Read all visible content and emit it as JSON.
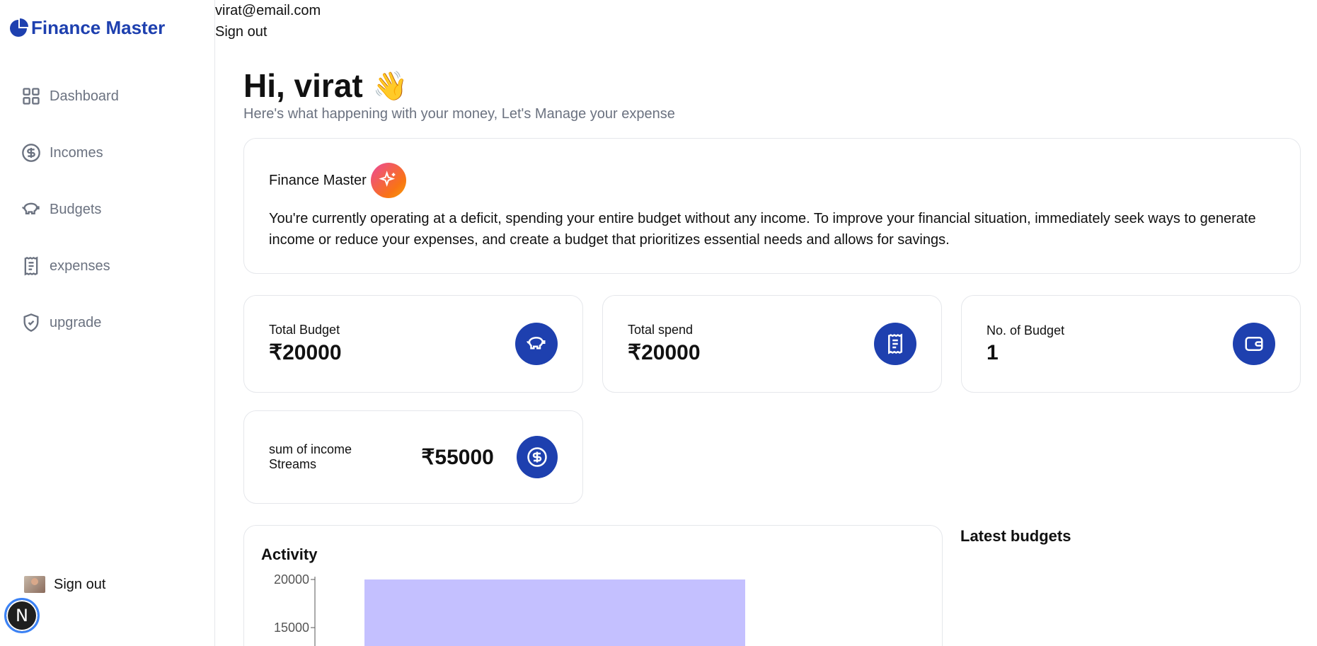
{
  "app": {
    "name": "Finance Master",
    "brand_color": "#1e40af"
  },
  "sidebar": {
    "items": [
      {
        "label": "Dashboard",
        "icon": "grid-icon"
      },
      {
        "label": "Incomes",
        "icon": "dollar-circle-icon"
      },
      {
        "label": "Budgets",
        "icon": "piggy-bank-icon"
      },
      {
        "label": "expenses",
        "icon": "receipt-icon"
      },
      {
        "label": "upgrade",
        "icon": "shield-check-icon"
      }
    ],
    "sign_out": "Sign out"
  },
  "header": {
    "email": "virat@email.com",
    "sign_out": "Sign out"
  },
  "greeting": {
    "title": "Hi, virat",
    "emoji": "👋",
    "subtitle": "Here's what happening with your money, Let's Manage your expense"
  },
  "ai_card": {
    "title": "Finance Master",
    "text": "You're currently operating at a deficit, spending your entire budget without any income. To improve your financial situation, immediately seek ways to generate income or reduce your expenses, and create a budget that prioritizes essential needs and allows for savings."
  },
  "stats": [
    {
      "label": "Total Budget",
      "value": "₹20000",
      "icon": "piggy-bank-icon"
    },
    {
      "label": "Total spend",
      "value": "₹20000",
      "icon": "receipt-icon"
    },
    {
      "label": "No. of Budget",
      "value": "1",
      "icon": "wallet-icon"
    }
  ],
  "income": {
    "label": "sum of income Streams",
    "value": "₹55000",
    "icon": "dollar-circle-icon"
  },
  "activity": {
    "title": "Activity"
  },
  "latest": {
    "title": "Latest budgets"
  },
  "chart_data": {
    "type": "bar",
    "title": "Activity",
    "series": [
      {
        "values": [
          20000
        ],
        "color": "#c4c0ff"
      }
    ],
    "y_ticks": [
      "20000",
      "15000"
    ],
    "ylim": [
      0,
      20000
    ]
  },
  "dev_badge": "N"
}
